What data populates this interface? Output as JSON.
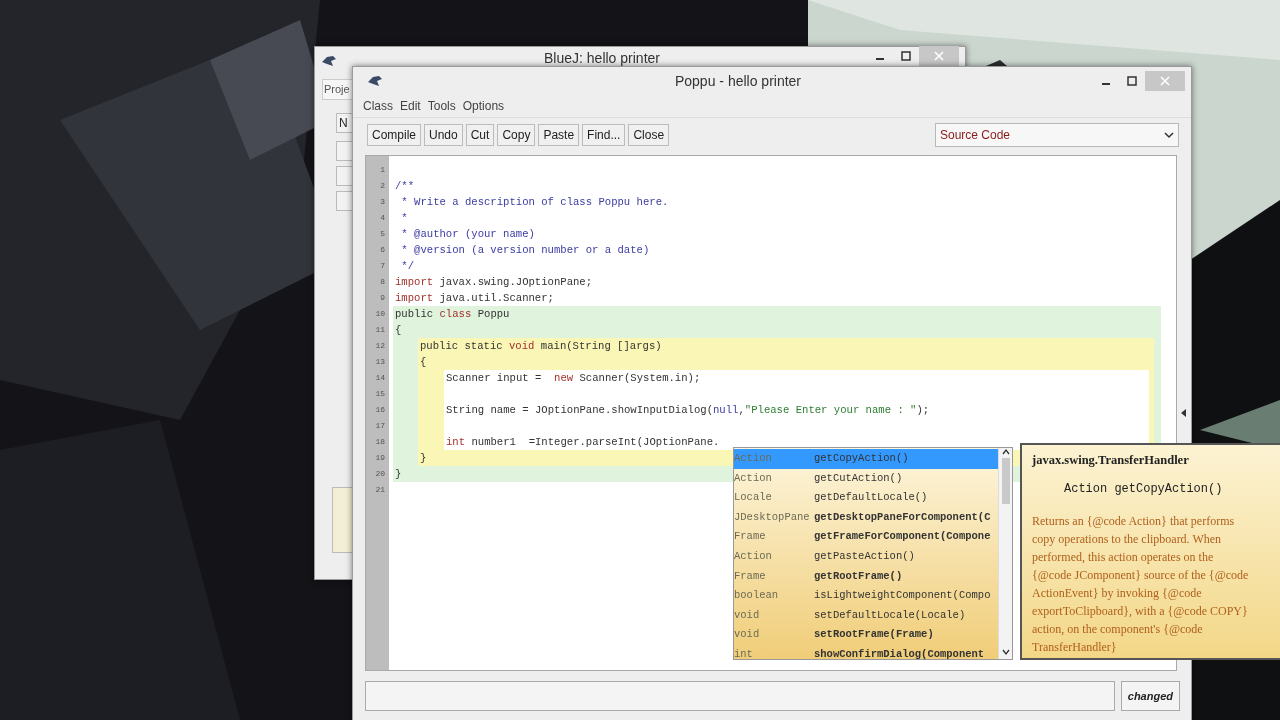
{
  "back_window": {
    "title": "BlueJ:  hello printer",
    "tab": "Proje",
    "button": "N"
  },
  "editor_window": {
    "title": "Poppu - hello printer",
    "menu": [
      "Class",
      "Edit",
      "Tools",
      "Options"
    ],
    "toolbar": [
      "Compile",
      "Undo",
      "Cut",
      "Copy",
      "Paste",
      "Find...",
      "Close"
    ],
    "view_select": "Source Code",
    "code_lines": [
      {
        "number": "1",
        "kind": "plain"
      },
      {
        "number": "2",
        "kind": "plain",
        "tokens": [
          {
            "text": "/**",
            "kind": "comment"
          }
        ]
      },
      {
        "number": "3",
        "kind": "plain",
        "tokens": [
          {
            "text": " * Write a description of class Poppu here.",
            "kind": "comment"
          }
        ]
      },
      {
        "number": "4",
        "kind": "plain",
        "tokens": [
          {
            "text": " *",
            "kind": "comment"
          }
        ]
      },
      {
        "number": "5",
        "kind": "plain",
        "tokens": [
          {
            "text": " * @author (your name)",
            "kind": "comment"
          }
        ]
      },
      {
        "number": "6",
        "kind": "plain",
        "tokens": [
          {
            "text": " * @version (a version number or a date)",
            "kind": "comment"
          }
        ]
      },
      {
        "number": "7",
        "kind": "plain",
        "tokens": [
          {
            "text": " */",
            "kind": "comment"
          }
        ]
      },
      {
        "number": "8",
        "kind": "plain",
        "tokens": [
          {
            "text": "import",
            "kind": "keyword"
          },
          {
            "text": " javax.swing.JOptionPane;",
            "kind": "plain"
          }
        ]
      },
      {
        "number": "9",
        "kind": "plain",
        "tokens": [
          {
            "text": "import",
            "kind": "keyword"
          },
          {
            "text": " java.util.Scanner;",
            "kind": "plain"
          }
        ]
      },
      {
        "number": "10",
        "kind": "class",
        "tokens": [
          {
            "text": "public ",
            "kind": "plain"
          },
          {
            "text": "class",
            "kind": "keyword"
          },
          {
            "text": " Poppu",
            "kind": "plain"
          }
        ]
      },
      {
        "number": "11",
        "kind": "class",
        "tokens": [
          {
            "text": "{",
            "kind": "plain"
          }
        ]
      },
      {
        "number": "12",
        "kind": "method",
        "tokens": [
          {
            "text": "public static ",
            "kind": "plain"
          },
          {
            "text": "void",
            "kind": "keyword"
          },
          {
            "text": " main(String []args)",
            "kind": "plain"
          }
        ]
      },
      {
        "number": "13",
        "kind": "method",
        "tokens": [
          {
            "text": "{",
            "kind": "plain"
          }
        ]
      },
      {
        "number": "14",
        "kind": "body",
        "tokens": [
          {
            "text": "Scanner input =  ",
            "kind": "plain"
          },
          {
            "text": "new",
            "kind": "keyword"
          },
          {
            "text": " Scanner(System.in);",
            "kind": "plain"
          }
        ]
      },
      {
        "number": "15",
        "kind": "body"
      },
      {
        "number": "16",
        "kind": "body",
        "tokens": [
          {
            "text": "String name = JOptionPane.showInputDialog(",
            "kind": "plain"
          },
          {
            "text": "null",
            "kind": "literal"
          },
          {
            "text": ",",
            "kind": "plain"
          },
          {
            "text": "\"Please Enter your name : \"",
            "kind": "string"
          },
          {
            "text": ");",
            "kind": "plain"
          }
        ]
      },
      {
        "number": "17",
        "kind": "body"
      },
      {
        "number": "18",
        "kind": "body",
        "tokens": [
          {
            "text": "int",
            "kind": "keyword"
          },
          {
            "text": " number1  =Integer.parseInt(JOptionPane.",
            "kind": "plain"
          }
        ]
      },
      {
        "number": "19",
        "kind": "method",
        "tokens": [
          {
            "text": "}",
            "kind": "plain"
          }
        ]
      },
      {
        "number": "20",
        "kind": "class",
        "tokens": [
          {
            "text": "}",
            "kind": "plain"
          }
        ]
      },
      {
        "number": "21",
        "kind": "plain"
      }
    ],
    "status": "changed"
  },
  "completion": {
    "items": [
      {
        "type": "Action",
        "method": "getCopyAction()",
        "declared_here": false,
        "selected": true
      },
      {
        "type": "Action",
        "method": "getCutAction()",
        "declared_here": false,
        "selected": false
      },
      {
        "type": "Locale",
        "method": "getDefaultLocale()",
        "declared_here": false,
        "selected": false
      },
      {
        "type": "JDesktopPane",
        "method": "getDesktopPaneForComponent(C",
        "declared_here": true,
        "selected": false
      },
      {
        "type": "Frame",
        "method": "getFrameForComponent(Compone",
        "declared_here": true,
        "selected": false
      },
      {
        "type": "Action",
        "method": "getPasteAction()",
        "declared_here": false,
        "selected": false
      },
      {
        "type": "Frame",
        "method": "getRootFrame()",
        "declared_here": true,
        "selected": false
      },
      {
        "type": "boolean",
        "method": "isLightweightComponent(Compo",
        "declared_here": false,
        "selected": false
      },
      {
        "type": "void",
        "method": "setDefaultLocale(Locale)",
        "declared_here": false,
        "selected": false
      },
      {
        "type": "void",
        "method": "setRootFrame(Frame)",
        "declared_here": true,
        "selected": false
      },
      {
        "type": "int",
        "method": "showConfirmDialog(Component",
        "declared_here": true,
        "selected": false
      }
    ]
  },
  "doc": {
    "class": "javax.swing.TransferHandler",
    "signature": "Action getCopyAction()",
    "description_lines": [
      "Returns an {@code Action} that performs",
      "copy operations to the clipboard. When",
      "performed, this action operates on the",
      "{@code JComponent} source of the {@code",
      "ActionEvent} by invoking {@code",
      "exportToClipboard}, with a {@code COPY}",
      "action, on the component's {@code",
      "TransferHandler}"
    ]
  }
}
